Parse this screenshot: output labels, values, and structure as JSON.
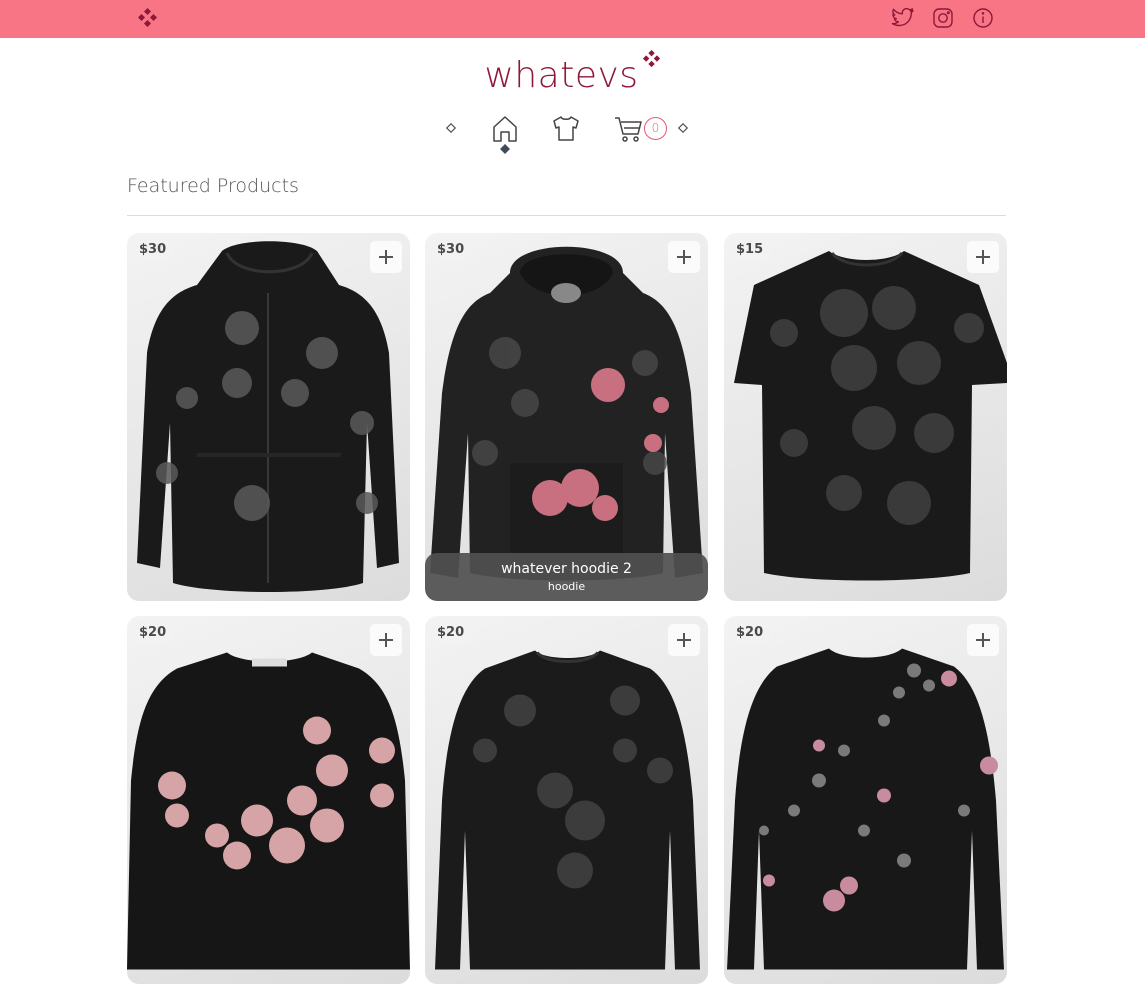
{
  "brand": {
    "title": "whatevs",
    "color": "#8e1838",
    "topbar_color": "#f87585"
  },
  "topbar": {
    "icons": [
      "logo-diamond-icon",
      "twitter-icon",
      "instagram-icon",
      "info-icon"
    ]
  },
  "nav": {
    "items": [
      "home-icon",
      "shirt-icon",
      "cart-icon"
    ],
    "active": "home",
    "cart_count": "0"
  },
  "section": {
    "title": "Featured Products"
  },
  "products": [
    {
      "price": "$30",
      "kind": "zip-hoodie"
    },
    {
      "price": "$30",
      "kind": "hoodie",
      "name": "whatever hoodie 2",
      "category": "hoodie"
    },
    {
      "price": "$15",
      "kind": "tshirt"
    },
    {
      "price": "$20",
      "kind": "sweatshirt"
    },
    {
      "price": "$20",
      "kind": "longsleeve"
    },
    {
      "price": "$20",
      "kind": "longsleeve-floral"
    }
  ]
}
